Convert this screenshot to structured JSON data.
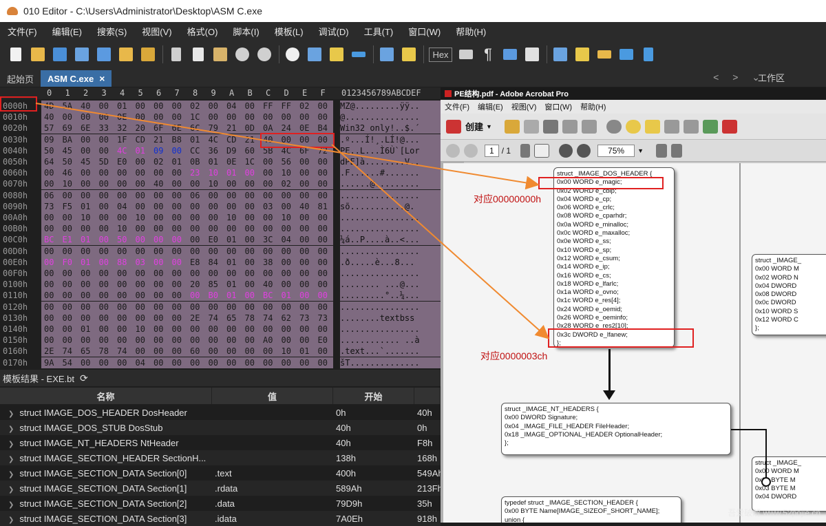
{
  "title": "010 Editor - C:\\Users\\Administrator\\Desktop\\ASM C.exe",
  "menu": [
    "文件(F)",
    "编辑(E)",
    "搜索(S)",
    "视图(V)",
    "格式(O)",
    "脚本(I)",
    "模板(L)",
    "调试(D)",
    "工具(T)",
    "窗口(W)",
    "帮助(H)"
  ],
  "toolbar": {
    "hex_label": "Hex"
  },
  "tabs": [
    {
      "label": "起始页"
    },
    {
      "label": "ASM C.exe"
    }
  ],
  "tab_close": "×",
  "workarea_label": "工作区",
  "hex_header": {
    "cols": [
      "0",
      "1",
      "2",
      "3",
      "4",
      "5",
      "6",
      "7",
      "8",
      "9",
      "A",
      "B",
      "C",
      "D",
      "E",
      "F"
    ],
    "chars": "0123456789ABCDEF"
  },
  "hex_rows": [
    {
      "addr": "0000h",
      "bytes": [
        "4D",
        "5A",
        "40",
        "00",
        "01",
        "00",
        "00",
        "00",
        "02",
        "00",
        "04",
        "00",
        "FF",
        "FF",
        "02",
        "00"
      ],
      "chars": "MZ@.........ÿÿ.."
    },
    {
      "addr": "0010h",
      "bytes": [
        "40",
        "00",
        "00",
        "00",
        "0E",
        "00",
        "00",
        "00",
        "1C",
        "00",
        "00",
        "00",
        "00",
        "00",
        "00",
        "00"
      ],
      "chars": "@..............."
    },
    {
      "addr": "0020h",
      "bytes": [
        "57",
        "69",
        "6E",
        "33",
        "32",
        "20",
        "6F",
        "6E",
        "6C",
        "79",
        "21",
        "0D",
        "0A",
        "24",
        "0E",
        "B4"
      ],
      "chars": "Win32 only!..$.´"
    },
    {
      "addr": "0030h",
      "bytes": [
        "09",
        "BA",
        "00",
        "00",
        "1F",
        "CD",
        "21",
        "B8",
        "01",
        "4C",
        "CD",
        "21",
        "40",
        "00",
        "00",
        "00"
      ],
      "chars": ".º...Í!¸.LÍ!@..."
    },
    {
      "addr": "0040h",
      "bytes": [
        "50",
        "45",
        "00",
        "00",
        "4C",
        "01",
        "09",
        "00",
        "CC",
        "36",
        "D9",
        "60",
        "5B",
        "4C",
        "6F",
        "72"
      ],
      "chars": "PE..L...Ì6Ù`[Lor"
    },
    {
      "addr": "0050h",
      "bytes": [
        "64",
        "50",
        "45",
        "5D",
        "E0",
        "00",
        "02",
        "01",
        "0B",
        "01",
        "0E",
        "1C",
        "00",
        "56",
        "00",
        "00"
      ],
      "chars": "dPE]à........V.."
    },
    {
      "addr": "0060h",
      "bytes": [
        "00",
        "46",
        "00",
        "00",
        "00",
        "00",
        "00",
        "00",
        "23",
        "10",
        "01",
        "00",
        "00",
        "10",
        "00",
        "00"
      ],
      "chars": ".F......#......."
    },
    {
      "addr": "0070h",
      "bytes": [
        "00",
        "10",
        "00",
        "00",
        "00",
        "00",
        "40",
        "00",
        "00",
        "10",
        "00",
        "00",
        "00",
        "02",
        "00",
        "00"
      ],
      "chars": "......@........."
    },
    {
      "addr": "0080h",
      "bytes": [
        "06",
        "00",
        "00",
        "00",
        "00",
        "00",
        "00",
        "00",
        "06",
        "00",
        "00",
        "00",
        "00",
        "00",
        "00",
        "00"
      ],
      "chars": "................"
    },
    {
      "addr": "0090h",
      "bytes": [
        "73",
        "F5",
        "01",
        "00",
        "04",
        "00",
        "00",
        "00",
        "00",
        "00",
        "00",
        "00",
        "03",
        "00",
        "40",
        "81"
      ],
      "chars": "sõ...........@."
    },
    {
      "addr": "00A0h",
      "bytes": [
        "00",
        "00",
        "10",
        "00",
        "00",
        "10",
        "00",
        "00",
        "00",
        "00",
        "10",
        "00",
        "00",
        "10",
        "00",
        "00"
      ],
      "chars": "................"
    },
    {
      "addr": "00B0h",
      "bytes": [
        "00",
        "00",
        "00",
        "00",
        "10",
        "00",
        "00",
        "00",
        "00",
        "00",
        "00",
        "00",
        "00",
        "00",
        "00",
        "00"
      ],
      "chars": "................"
    },
    {
      "addr": "00C0h",
      "bytes": [
        "BC",
        "E1",
        "01",
        "00",
        "50",
        "00",
        "00",
        "00",
        "00",
        "E0",
        "01",
        "00",
        "3C",
        "04",
        "00",
        "00"
      ],
      "chars": "¼á..P....à..<..."
    },
    {
      "addr": "00D0h",
      "bytes": [
        "00",
        "00",
        "00",
        "00",
        "00",
        "00",
        "00",
        "00",
        "00",
        "00",
        "00",
        "00",
        "00",
        "00",
        "00",
        "00"
      ],
      "chars": "................"
    },
    {
      "addr": "00E0h",
      "bytes": [
        "00",
        "F0",
        "01",
        "00",
        "88",
        "03",
        "00",
        "00",
        "E8",
        "84",
        "01",
        "00",
        "38",
        "00",
        "00",
        "00"
      ],
      "chars": ".ð.....è...8..."
    },
    {
      "addr": "00F0h",
      "bytes": [
        "00",
        "00",
        "00",
        "00",
        "00",
        "00",
        "00",
        "00",
        "00",
        "00",
        "00",
        "00",
        "00",
        "00",
        "00",
        "00"
      ],
      "chars": "................"
    },
    {
      "addr": "0100h",
      "bytes": [
        "00",
        "00",
        "00",
        "00",
        "00",
        "00",
        "00",
        "00",
        "20",
        "85",
        "01",
        "00",
        "40",
        "00",
        "00",
        "00"
      ],
      "chars": "........ ...@..."
    },
    {
      "addr": "0110h",
      "bytes": [
        "00",
        "00",
        "00",
        "00",
        "00",
        "00",
        "00",
        "00",
        "00",
        "B0",
        "01",
        "00",
        "BC",
        "01",
        "00",
        "00"
      ],
      "chars": ".........°..¼..."
    },
    {
      "addr": "0120h",
      "bytes": [
        "00",
        "00",
        "00",
        "00",
        "00",
        "00",
        "00",
        "00",
        "00",
        "00",
        "00",
        "00",
        "00",
        "00",
        "00",
        "00"
      ],
      "chars": "................"
    },
    {
      "addr": "0130h",
      "bytes": [
        "00",
        "00",
        "00",
        "00",
        "00",
        "00",
        "00",
        "00",
        "2E",
        "74",
        "65",
        "78",
        "74",
        "62",
        "73",
        "73"
      ],
      "chars": "........textbss"
    },
    {
      "addr": "0140h",
      "bytes": [
        "00",
        "00",
        "01",
        "00",
        "00",
        "10",
        "00",
        "00",
        "00",
        "00",
        "00",
        "00",
        "00",
        "00",
        "00",
        "00"
      ],
      "chars": "................"
    },
    {
      "addr": "0150h",
      "bytes": [
        "00",
        "00",
        "00",
        "00",
        "00",
        "00",
        "00",
        "00",
        "00",
        "00",
        "00",
        "00",
        "A0",
        "00",
        "00",
        "E0"
      ],
      "chars": "............ ..à"
    },
    {
      "addr": "0160h",
      "bytes": [
        "2E",
        "74",
        "65",
        "78",
        "74",
        "00",
        "00",
        "00",
        "60",
        "00",
        "00",
        "00",
        "00",
        "10",
        "01",
        "00"
      ],
      "chars": ".text...`......."
    },
    {
      "addr": "0170h",
      "bytes": [
        "9A",
        "54",
        "00",
        "00",
        "00",
        "04",
        "00",
        "00",
        "00",
        "00",
        "00",
        "00",
        "00",
        "00",
        "00",
        "00"
      ],
      "chars": "šT.............."
    }
  ],
  "template": {
    "title": "模板结果 - EXE.bt",
    "refresh_icon": "refresh-icon",
    "columns": [
      "名称",
      "值",
      "开始",
      ""
    ],
    "rows": [
      {
        "name": "struct IMAGE_DOS_HEADER DosHeader",
        "value": "",
        "start": "0h",
        "size": "40h"
      },
      {
        "name": "struct IMAGE_DOS_STUB DosStub",
        "value": "",
        "start": "40h",
        "size": "0h"
      },
      {
        "name": "struct IMAGE_NT_HEADERS NtHeader",
        "value": "",
        "start": "40h",
        "size": "F8h"
      },
      {
        "name": "struct IMAGE_SECTION_HEADER SectionH...",
        "value": "",
        "start": "138h",
        "size": "168h"
      },
      {
        "name": "struct IMAGE_SECTION_DATA Section[0]",
        "value": ".text",
        "start": "400h",
        "size": "549Ah"
      },
      {
        "name": "struct IMAGE_SECTION_DATA Section[1]",
        "value": ".rdata",
        "start": "589Ah",
        "size": "213Fh"
      },
      {
        "name": "struct IMAGE_SECTION_DATA Section[2]",
        "value": ".data",
        "start": "79D9h",
        "size": "35h"
      },
      {
        "name": "struct IMAGE_SECTION_DATA Section[3]",
        "value": ".idata",
        "start": "7A0Eh",
        "size": "918h"
      }
    ]
  },
  "acrobat": {
    "title": "PE结构.pdf - Adobe Acrobat Pro",
    "menu": [
      "文件(F)",
      "编辑(E)",
      "视图(V)",
      "窗口(W)",
      "帮助(H)"
    ],
    "create_label": "创建",
    "page_current": "1",
    "page_total": "/ 1",
    "zoom": "75%",
    "dos_header": [
      "struct _IMAGE_DOS_HEADER {",
      "0x00  WORD e_magic;",
      "0x02  WORD e_cblp;",
      "0x04  WORD e_cp;",
      "0x06  WORD e_crlc;",
      "0x08  WORD e_cparhdr;",
      "0x0a  WORD e_minalloc;",
      "0x0c  WORD e_maxalloc;",
      "0x0e  WORD e_ss;",
      "0x10  WORD e_sp;",
      "0x12  WORD e_csum;",
      "0x14  WORD e_ip;",
      "0x16  WORD e_cs;",
      "0x18  WORD e_lfarlc;",
      "0x1a  WORD e_ovno;",
      "0x1c  WORD e_res[4];",
      "0x24  WORD e_oemid;",
      "0x26  WORD e_oeminfo;",
      "0x28  WORD e_res2[10];",
      "0x3c  DWORD e_lfanew;",
      "};"
    ],
    "nt_headers": [
      "struct _IMAGE_NT_HEADERS {",
      "0x00  DWORD Signature;",
      "0x04  _IMAGE_FILE_HEADER FileHeader;",
      "0x18  _IMAGE_OPTIONAL_HEADER OptionalHeader;",
      "};"
    ],
    "section_header": [
      "typedef struct _IMAGE_SECTION_HEADER {",
      "0x00  BYTE  Name[IMAGE_SIZEOF_SHORT_NAME];",
      "      union {"
    ],
    "right_box1": [
      "struct _IMAGE_",
      "0x00  WORD M",
      "0x02  WORD N",
      "0x04  DWORD",
      "0x08  DWORD",
      "0x0c  DWORD",
      "0x10  WORD S",
      "0x12  WORD C",
      "};"
    ],
    "right_box2": [
      "struct _IMAGE_",
      "0x00  WORD M",
      "0x02  BYTE M",
      "0x03  BYTE M",
      "0x04  DWORD"
    ],
    "anno1": "对应00000000h",
    "anno2": "对应0000003ch",
    "watermark": "吾爱破解 www.52pojie.cn"
  },
  "colors": {
    "highlight_red": "#e02020",
    "arrow_orange": "#f08a30",
    "magenta": "#e040e0",
    "blue": "#1030d0"
  }
}
